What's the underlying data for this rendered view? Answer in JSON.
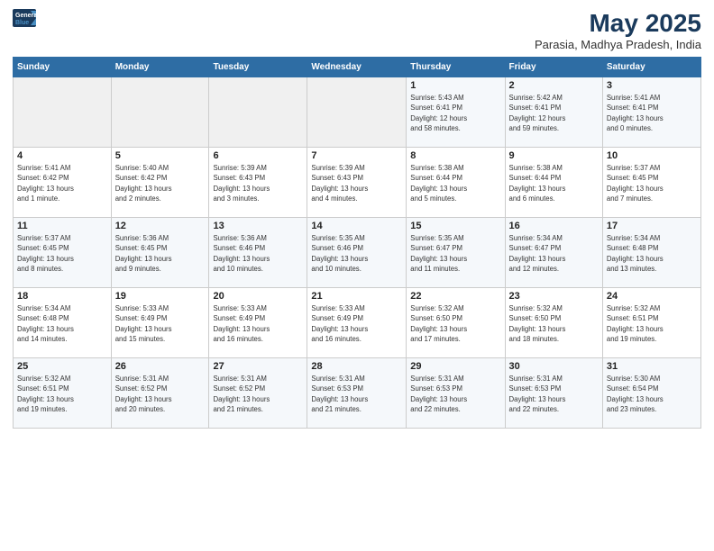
{
  "logo": {
    "line1": "General",
    "line2": "Blue"
  },
  "title": "May 2025",
  "subtitle": "Parasia, Madhya Pradesh, India",
  "headers": [
    "Sunday",
    "Monday",
    "Tuesday",
    "Wednesday",
    "Thursday",
    "Friday",
    "Saturday"
  ],
  "weeks": [
    [
      {
        "day": "",
        "info": ""
      },
      {
        "day": "",
        "info": ""
      },
      {
        "day": "",
        "info": ""
      },
      {
        "day": "",
        "info": ""
      },
      {
        "day": "1",
        "info": "Sunrise: 5:43 AM\nSunset: 6:41 PM\nDaylight: 12 hours\nand 58 minutes."
      },
      {
        "day": "2",
        "info": "Sunrise: 5:42 AM\nSunset: 6:41 PM\nDaylight: 12 hours\nand 59 minutes."
      },
      {
        "day": "3",
        "info": "Sunrise: 5:41 AM\nSunset: 6:41 PM\nDaylight: 13 hours\nand 0 minutes."
      }
    ],
    [
      {
        "day": "4",
        "info": "Sunrise: 5:41 AM\nSunset: 6:42 PM\nDaylight: 13 hours\nand 1 minute."
      },
      {
        "day": "5",
        "info": "Sunrise: 5:40 AM\nSunset: 6:42 PM\nDaylight: 13 hours\nand 2 minutes."
      },
      {
        "day": "6",
        "info": "Sunrise: 5:39 AM\nSunset: 6:43 PM\nDaylight: 13 hours\nand 3 minutes."
      },
      {
        "day": "7",
        "info": "Sunrise: 5:39 AM\nSunset: 6:43 PM\nDaylight: 13 hours\nand 4 minutes."
      },
      {
        "day": "8",
        "info": "Sunrise: 5:38 AM\nSunset: 6:44 PM\nDaylight: 13 hours\nand 5 minutes."
      },
      {
        "day": "9",
        "info": "Sunrise: 5:38 AM\nSunset: 6:44 PM\nDaylight: 13 hours\nand 6 minutes."
      },
      {
        "day": "10",
        "info": "Sunrise: 5:37 AM\nSunset: 6:45 PM\nDaylight: 13 hours\nand 7 minutes."
      }
    ],
    [
      {
        "day": "11",
        "info": "Sunrise: 5:37 AM\nSunset: 6:45 PM\nDaylight: 13 hours\nand 8 minutes."
      },
      {
        "day": "12",
        "info": "Sunrise: 5:36 AM\nSunset: 6:45 PM\nDaylight: 13 hours\nand 9 minutes."
      },
      {
        "day": "13",
        "info": "Sunrise: 5:36 AM\nSunset: 6:46 PM\nDaylight: 13 hours\nand 10 minutes."
      },
      {
        "day": "14",
        "info": "Sunrise: 5:35 AM\nSunset: 6:46 PM\nDaylight: 13 hours\nand 10 minutes."
      },
      {
        "day": "15",
        "info": "Sunrise: 5:35 AM\nSunset: 6:47 PM\nDaylight: 13 hours\nand 11 minutes."
      },
      {
        "day": "16",
        "info": "Sunrise: 5:34 AM\nSunset: 6:47 PM\nDaylight: 13 hours\nand 12 minutes."
      },
      {
        "day": "17",
        "info": "Sunrise: 5:34 AM\nSunset: 6:48 PM\nDaylight: 13 hours\nand 13 minutes."
      }
    ],
    [
      {
        "day": "18",
        "info": "Sunrise: 5:34 AM\nSunset: 6:48 PM\nDaylight: 13 hours\nand 14 minutes."
      },
      {
        "day": "19",
        "info": "Sunrise: 5:33 AM\nSunset: 6:49 PM\nDaylight: 13 hours\nand 15 minutes."
      },
      {
        "day": "20",
        "info": "Sunrise: 5:33 AM\nSunset: 6:49 PM\nDaylight: 13 hours\nand 16 minutes."
      },
      {
        "day": "21",
        "info": "Sunrise: 5:33 AM\nSunset: 6:49 PM\nDaylight: 13 hours\nand 16 minutes."
      },
      {
        "day": "22",
        "info": "Sunrise: 5:32 AM\nSunset: 6:50 PM\nDaylight: 13 hours\nand 17 minutes."
      },
      {
        "day": "23",
        "info": "Sunrise: 5:32 AM\nSunset: 6:50 PM\nDaylight: 13 hours\nand 18 minutes."
      },
      {
        "day": "24",
        "info": "Sunrise: 5:32 AM\nSunset: 6:51 PM\nDaylight: 13 hours\nand 19 minutes."
      }
    ],
    [
      {
        "day": "25",
        "info": "Sunrise: 5:32 AM\nSunset: 6:51 PM\nDaylight: 13 hours\nand 19 minutes."
      },
      {
        "day": "26",
        "info": "Sunrise: 5:31 AM\nSunset: 6:52 PM\nDaylight: 13 hours\nand 20 minutes."
      },
      {
        "day": "27",
        "info": "Sunrise: 5:31 AM\nSunset: 6:52 PM\nDaylight: 13 hours\nand 21 minutes."
      },
      {
        "day": "28",
        "info": "Sunrise: 5:31 AM\nSunset: 6:53 PM\nDaylight: 13 hours\nand 21 minutes."
      },
      {
        "day": "29",
        "info": "Sunrise: 5:31 AM\nSunset: 6:53 PM\nDaylight: 13 hours\nand 22 minutes."
      },
      {
        "day": "30",
        "info": "Sunrise: 5:31 AM\nSunset: 6:53 PM\nDaylight: 13 hours\nand 22 minutes."
      },
      {
        "day": "31",
        "info": "Sunrise: 5:30 AM\nSunset: 6:54 PM\nDaylight: 13 hours\nand 23 minutes."
      }
    ]
  ]
}
